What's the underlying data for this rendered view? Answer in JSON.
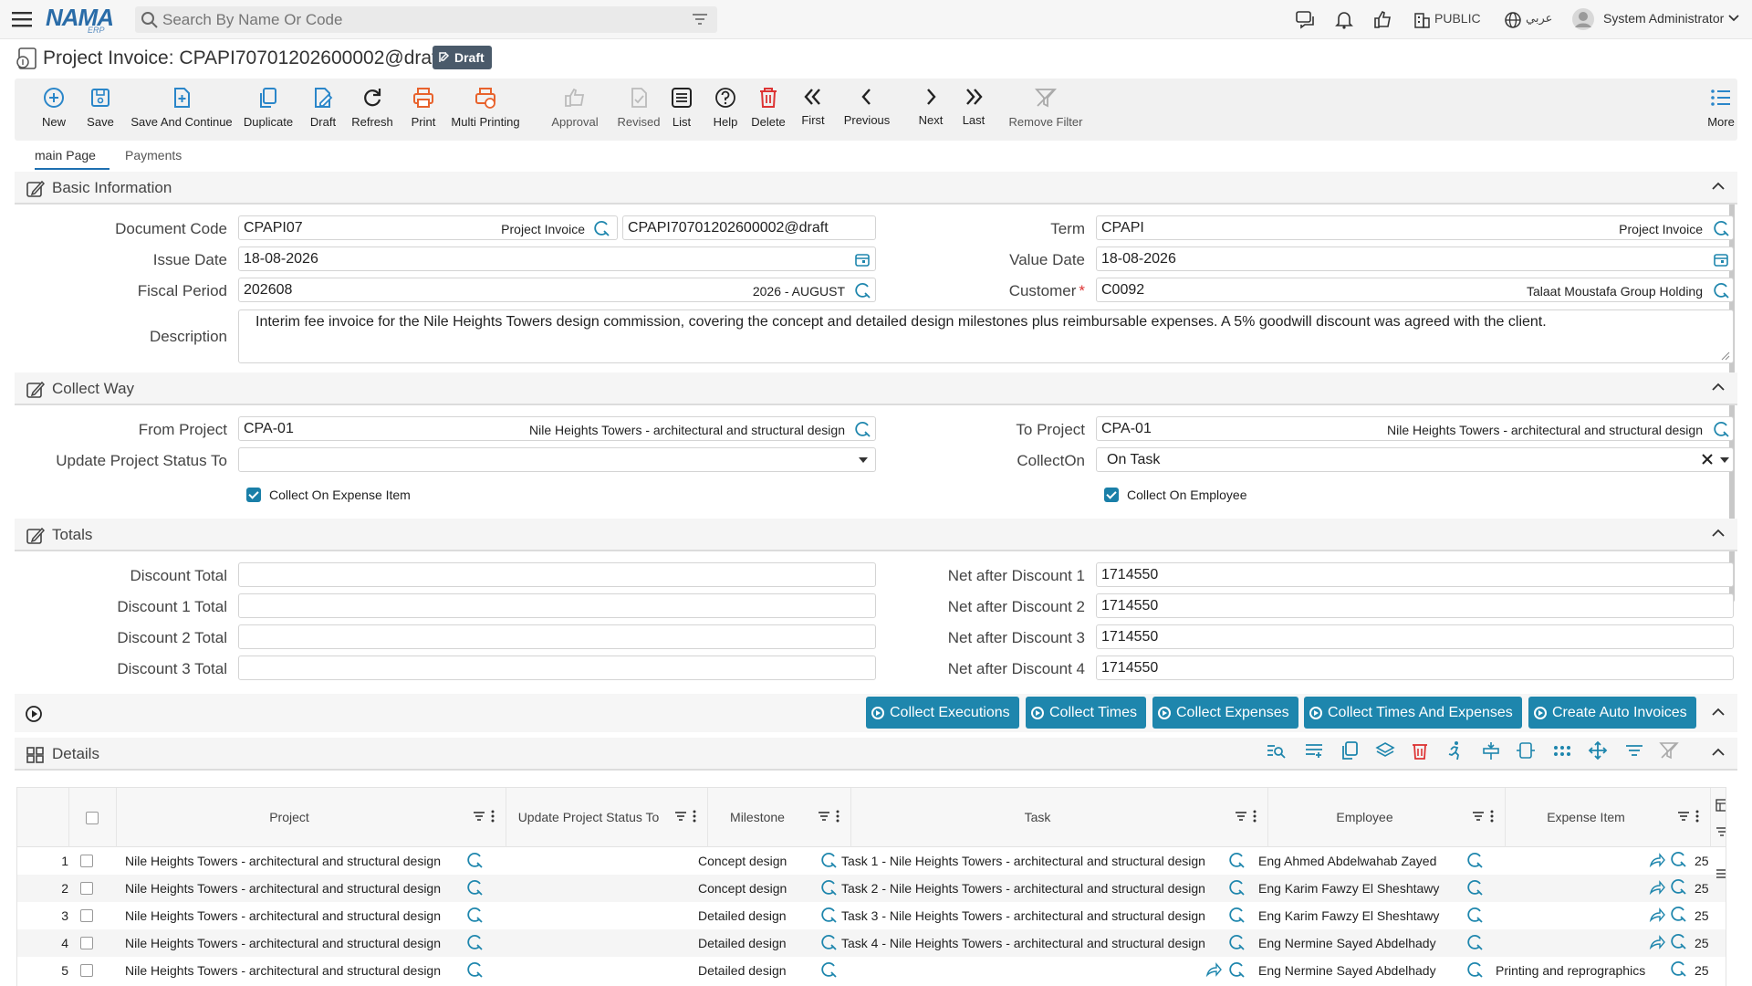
{
  "app": {
    "logo_main": "NAMA",
    "logo_sub": "ERP"
  },
  "topbar": {
    "search_placeholder": "Search By Name Or Code",
    "public_label": "PUBLIC",
    "lang_label": "عربي",
    "user_name": "System Administrator"
  },
  "page": {
    "title": "Project Invoice: CPAPI70701202600002@draft",
    "status_badge": "Draft"
  },
  "toolbar": {
    "buttons": [
      {
        "label": "New",
        "icon": "plus-circle-icon"
      },
      {
        "label": "Save",
        "icon": "save-icon"
      },
      {
        "label": "Save And Continue",
        "icon": "save-continue-icon"
      },
      {
        "label": "Duplicate",
        "icon": "duplicate-icon"
      },
      {
        "label": "Draft",
        "icon": "draft-icon"
      },
      {
        "label": "Refresh",
        "icon": "refresh-icon"
      },
      {
        "label": "Print",
        "icon": "print-icon"
      },
      {
        "label": "Multi Printing",
        "icon": "multi-print-icon"
      },
      {
        "label": "Approval",
        "icon": "thumb-up-icon"
      },
      {
        "label": "Revised",
        "icon": "revised-icon"
      },
      {
        "label": "List",
        "icon": "list-icon"
      },
      {
        "label": "Help",
        "icon": "help-icon"
      },
      {
        "label": "Delete",
        "icon": "trash-icon"
      },
      {
        "label": "First",
        "icon": "first-icon"
      },
      {
        "label": "Previous",
        "icon": "previous-icon"
      },
      {
        "label": "Next",
        "icon": "next-icon"
      },
      {
        "label": "Last",
        "icon": "last-icon"
      },
      {
        "label": "Remove Filter",
        "icon": "remove-filter-icon"
      },
      {
        "label": "More",
        "icon": "more-icon"
      }
    ]
  },
  "tabs": [
    {
      "label": "main Page"
    },
    {
      "label": "Payments"
    }
  ],
  "basic": {
    "title": "Basic Information",
    "document_code": {
      "label": "Document Code",
      "value": "CPAPI07",
      "tag": "Project Invoice",
      "code": "CPAPI70701202600002@draft"
    },
    "term": {
      "label": "Term",
      "value": "CPAPI",
      "tag": "Project Invoice"
    },
    "issue_date": {
      "label": "Issue Date",
      "value": "18-08-2026"
    },
    "value_date": {
      "label": "Value Date",
      "value": "18-08-2026"
    },
    "fiscal_period": {
      "label": "Fiscal Period",
      "value": "202608",
      "tag": "2026 - AUGUST"
    },
    "customer": {
      "label": "Customer",
      "required": "*",
      "value": "C0092",
      "tag": "Talaat Moustafa Group Holding"
    },
    "description": {
      "label": "Description",
      "value": "Interim fee invoice for the Nile Heights Towers design commission, covering the concept and detailed design milestones plus reimbursable expenses. A 5% goodwill discount was agreed with the client."
    }
  },
  "collect": {
    "title": "Collect Way",
    "from_project": {
      "label": "From Project",
      "value": "CPA-01",
      "tag": "Nile Heights Towers - architectural and structural design"
    },
    "to_project": {
      "label": "To Project",
      "value": "CPA-01",
      "tag": "Nile Heights Towers - architectural and structural design"
    },
    "update_status": {
      "label": "Update Project Status To",
      "value": ""
    },
    "collect_on": {
      "label": "CollectOn",
      "value": "On Task"
    },
    "expense_item_chk": "Collect On Expense Item",
    "employee_chk": "Collect On Employee"
  },
  "totals": {
    "title": "Totals",
    "left": [
      {
        "label": "Discount Total",
        "value": ""
      },
      {
        "label": "Discount 1 Total",
        "value": ""
      },
      {
        "label": "Discount 2 Total",
        "value": ""
      },
      {
        "label": "Discount 3 Total",
        "value": ""
      }
    ],
    "right": [
      {
        "label": "Net after Discount 1",
        "value": "1714550"
      },
      {
        "label": "Net after Discount 2",
        "value": "1714550"
      },
      {
        "label": "Net after Discount 3",
        "value": "1714550"
      },
      {
        "label": "Net after Discount 4",
        "value": "1714550"
      }
    ]
  },
  "actions": [
    {
      "label": "Collect Executions"
    },
    {
      "label": "Collect Times"
    },
    {
      "label": "Collect Expenses"
    },
    {
      "label": "Collect Times And Expenses"
    },
    {
      "label": "Create Auto Invoices"
    }
  ],
  "details": {
    "title": "Details",
    "columns": [
      "Project",
      "Update Project Status To",
      "Milestone",
      "Task",
      "Employee",
      "Expense Item"
    ],
    "rows": [
      {
        "n": "1",
        "project": "Nile Heights Towers - architectural and structural design",
        "status": "",
        "milestone": "Concept design",
        "task": "Task 1 - Nile Heights Towers - architectural and structural design",
        "employee": "Eng Ahmed Abdelwahab Zayed",
        "expense": "",
        "amt": "25"
      },
      {
        "n": "2",
        "project": "Nile Heights Towers - architectural and structural design",
        "status": "",
        "milestone": "Concept design",
        "task": "Task 2 - Nile Heights Towers - architectural and structural design",
        "employee": "Eng Karim Fawzy El Sheshtawy",
        "expense": "",
        "amt": "25"
      },
      {
        "n": "3",
        "project": "Nile Heights Towers - architectural and structural design",
        "status": "",
        "milestone": "Detailed design",
        "task": "Task 3 - Nile Heights Towers - architectural and structural design",
        "employee": "Eng Karim Fawzy El Sheshtawy",
        "expense": "",
        "amt": "25"
      },
      {
        "n": "4",
        "project": "Nile Heights Towers - architectural and structural design",
        "status": "",
        "milestone": "Detailed design",
        "task": "Task 4 - Nile Heights Towers - architectural and structural design",
        "employee": "Eng Nermine Sayed Abdelhady",
        "expense": "",
        "amt": "25"
      },
      {
        "n": "5",
        "project": "Nile Heights Towers - architectural and structural design",
        "status": "",
        "milestone": "Detailed design",
        "task": "",
        "employee": "Eng Nermine Sayed Abdelhady",
        "expense": "Printing and reprographics",
        "amt": "25"
      }
    ]
  },
  "colors": {
    "accent": "#1e86ad",
    "brand": "#2a6ca8",
    "header_bg": "#f6f6f6"
  }
}
